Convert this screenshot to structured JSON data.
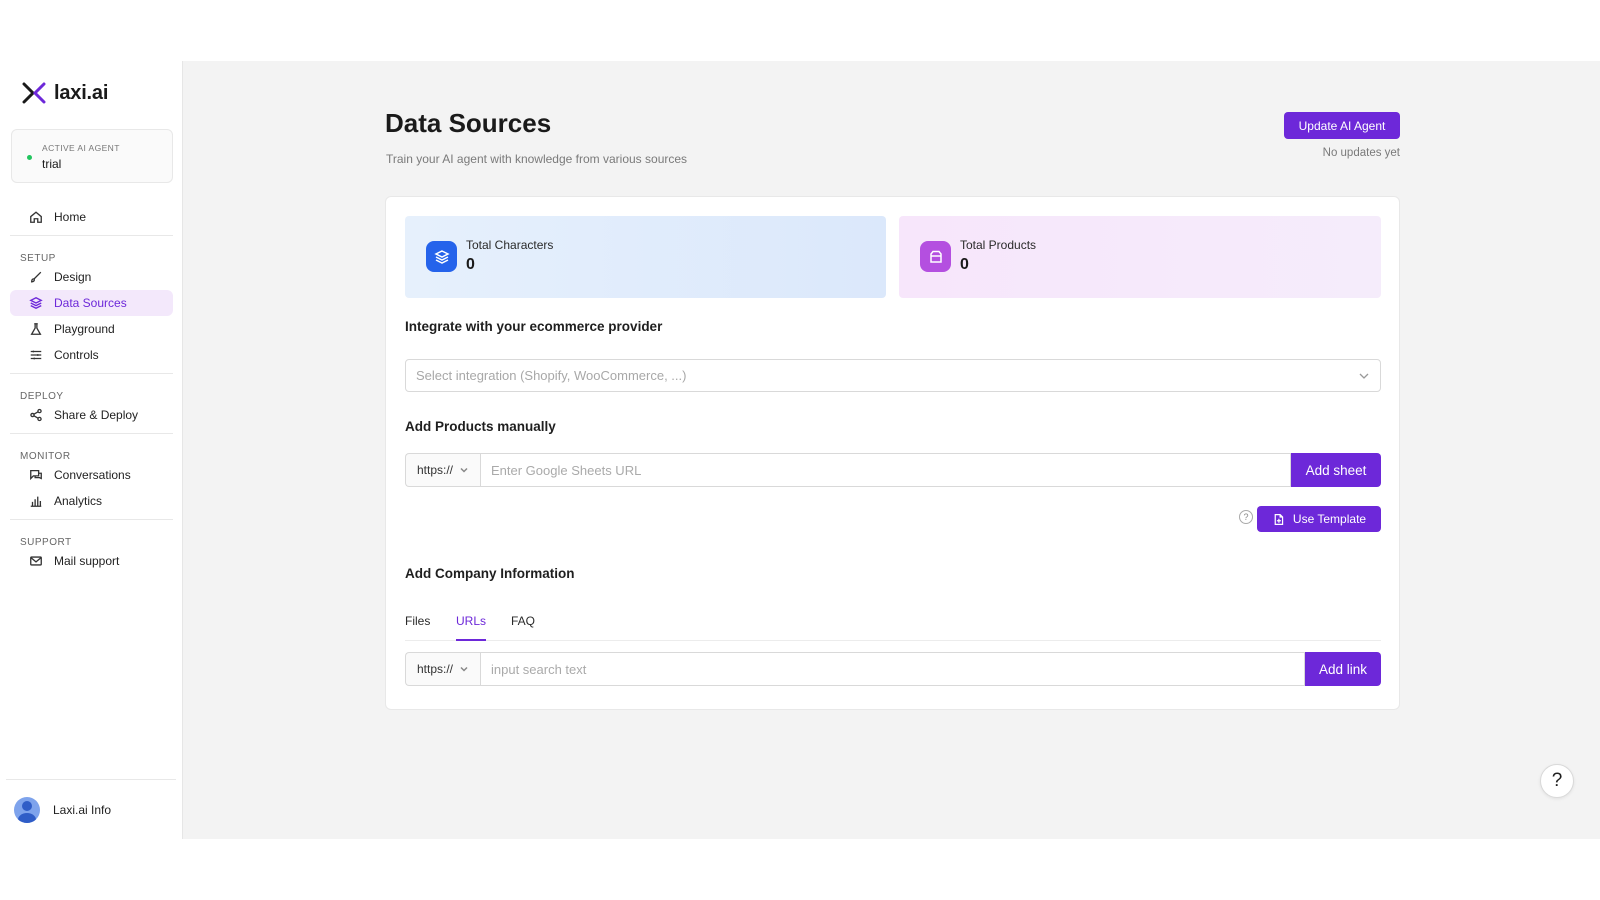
{
  "brand": {
    "name": "laxi.ai",
    "accent": "#6d28d9"
  },
  "agent": {
    "label": "ACTIVE AI AGENT",
    "name": "trial",
    "status_color": "#22c55e"
  },
  "nav": {
    "home": "Home",
    "setup_label": "SETUP",
    "design": "Design",
    "data_sources": "Data Sources",
    "playground": "Playground",
    "controls": "Controls",
    "deploy_label": "DEPLOY",
    "share_deploy": "Share & Deploy",
    "monitor_label": "MONITOR",
    "conversations": "Conversations",
    "analytics": "Analytics",
    "support_label": "SUPPORT",
    "mail_support": "Mail support"
  },
  "user": {
    "name": "Laxi.ai Info"
  },
  "page": {
    "title": "Data Sources",
    "subtitle": "Train your AI agent with knowledge from various sources",
    "update_button": "Update AI Agent",
    "update_status": "No updates yet"
  },
  "stats": {
    "characters": {
      "label": "Total Characters",
      "value": "0"
    },
    "products": {
      "label": "Total Products",
      "value": "0"
    }
  },
  "integration": {
    "title": "Integrate with your ecommerce provider",
    "placeholder": "Select integration (Shopify, WooCommerce, ...)"
  },
  "products_manual": {
    "title": "Add Products manually",
    "protocol": "https://",
    "placeholder": "Enter Google Sheets URL",
    "add_button": "Add sheet",
    "help": "?",
    "template_button": "Use Template"
  },
  "company": {
    "title": "Add Company Information",
    "tabs": [
      "Files",
      "URLs",
      "FAQ"
    ],
    "active_tab": "URLs",
    "protocol": "https://",
    "placeholder": "input search text",
    "add_button": "Add link"
  },
  "float_help": "?"
}
